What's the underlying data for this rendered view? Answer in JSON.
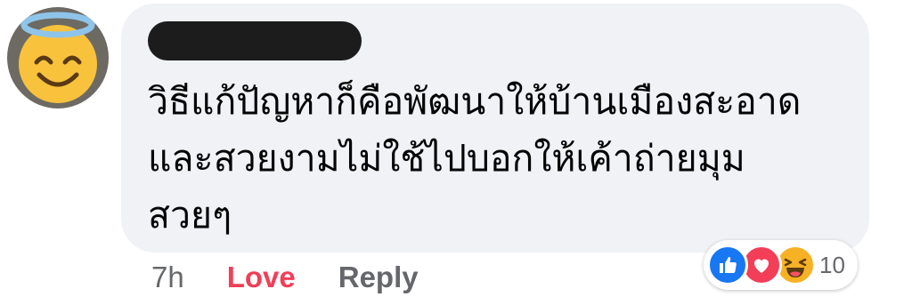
{
  "comment": {
    "text": "วิธีแก้ปัญหาก็คือพัฒนาให้บ้านเมืองสะอาด\nและสวยงามไม่ใช้ไปบอกให้เค้าถ่ายมุม\nสวยๆ"
  },
  "footer": {
    "time": "7h",
    "love_label": "Love",
    "reply_label": "Reply"
  },
  "reactions": {
    "icons": [
      "like-icon",
      "love-icon",
      "haha-icon"
    ],
    "count": "10"
  },
  "colors": {
    "bubble": "#f0f2f5",
    "love_accent": "#f33e58",
    "secondary_text": "#65676b",
    "like_blue": "#1877f2",
    "haha_yellow": "#f7b125"
  }
}
